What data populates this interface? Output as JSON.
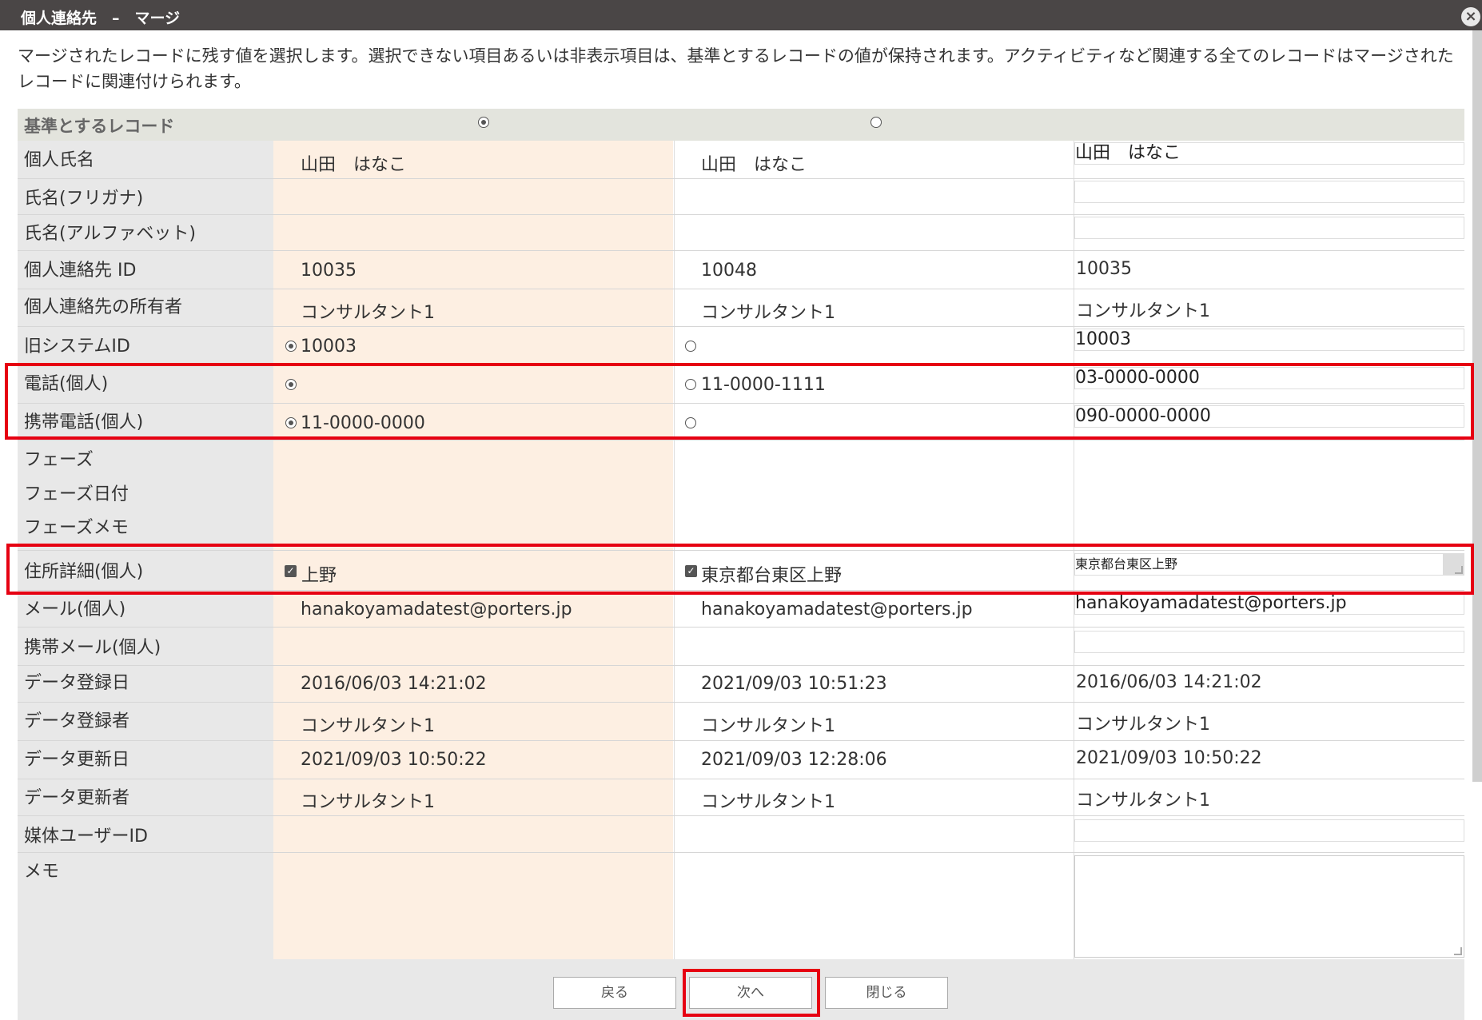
{
  "window": {
    "title": "個人連絡先　–　マージ",
    "close_glyph": "×"
  },
  "description": "マージされたレコードに残す値を選択します。選択できない項目あるいは非表示項目は、基準とするレコードの値が保持されます。アクティビティなど関連する全てのレコードはマージされたレコードに関連付けられます。",
  "base_record_label": "基準とするレコード",
  "labels": {
    "name": "個人氏名",
    "furigana": "氏名(フリガナ)",
    "alphabet": "氏名(アルファベット)",
    "contact_id": "個人連絡先 ID",
    "owner": "個人連絡先の所有者",
    "legacy_id": "旧システムID",
    "phone": "電話(個人)",
    "mobile": "携帯電話(個人)",
    "phase": "フェーズ",
    "phase_date": "フェーズ日付",
    "phase_memo": "フェーズメモ",
    "address": "住所詳細(個人)",
    "email": "メール(個人)",
    "mobile_email": "携帯メール(個人)",
    "created_at": "データ登録日",
    "created_by": "データ登録者",
    "updated_at": "データ更新日",
    "updated_by": "データ更新者",
    "media_user_id": "媒体ユーザーID",
    "memo": "メモ"
  },
  "record1": {
    "name": "山田　はなこ",
    "contact_id": "10035",
    "owner": "コンサルタント1",
    "legacy_id": "10003",
    "mobile": "11-0000-0000",
    "address": "上野",
    "email": "hanakoyamadatest@porters.jp",
    "created_at": "2016/06/03 14:21:02",
    "created_by": "コンサルタント1",
    "updated_at": "2021/09/03 10:50:22",
    "updated_by": "コンサルタント1"
  },
  "record2": {
    "name": "山田　はなこ",
    "contact_id": "10048",
    "owner": "コンサルタント1",
    "phone": "11-0000-1111",
    "address": "東京都台東区上野",
    "email": "hanakoyamadatest@porters.jp",
    "created_at": "2021/09/03 10:51:23",
    "created_by": "コンサルタント1",
    "updated_at": "2021/09/03 12:28:06",
    "updated_by": "コンサルタント1"
  },
  "merged": {
    "name": "山田　はなこ",
    "furigana": "",
    "alphabet": "",
    "contact_id": "10035",
    "owner": "コンサルタント1",
    "legacy_id": "10003",
    "phone": "03-0000-0000",
    "mobile": "090-0000-0000",
    "address": "東京都台東区上野",
    "email": "hanakoyamadatest@porters.jp",
    "mobile_email": "",
    "created_at": "2016/06/03 14:21:02",
    "created_by": "コンサルタント1",
    "updated_at": "2021/09/03 10:50:22",
    "updated_by": "コンサルタント1",
    "media_user_id": ""
  },
  "buttons": {
    "back": "戻る",
    "next": "次へ",
    "close": "閉じる"
  },
  "colors": {
    "highlight": "#e60012",
    "base_column": "#fdefe2",
    "titlebar": "#4a4646"
  }
}
